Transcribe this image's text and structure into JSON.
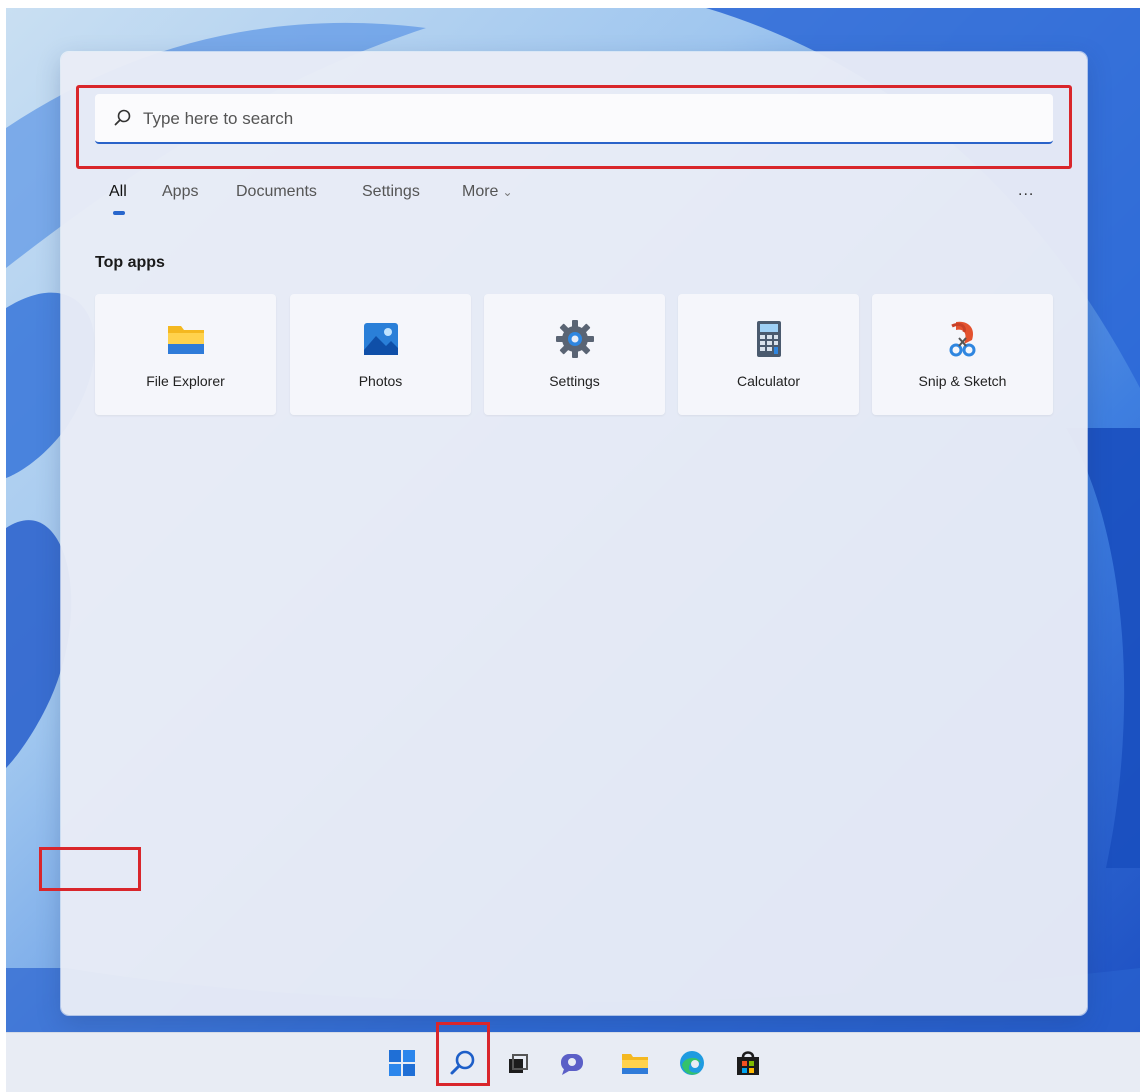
{
  "search": {
    "placeholder": "Type here to search",
    "icon": "search-icon"
  },
  "tabs": [
    {
      "label": "All",
      "active": true
    },
    {
      "label": "Apps",
      "active": false
    },
    {
      "label": "Documents",
      "active": false
    },
    {
      "label": "Settings",
      "active": false
    },
    {
      "label": "More",
      "active": false,
      "icon": "chevron-down-icon"
    }
  ],
  "overflow_menu_label": "...",
  "top_apps": {
    "heading": "Top apps",
    "items": [
      {
        "label": "File Explorer",
        "icon": "folder-icon"
      },
      {
        "label": "Photos",
        "icon": "photos-icon"
      },
      {
        "label": "Settings",
        "icon": "gear-icon"
      },
      {
        "label": "Calculator",
        "icon": "calculator-icon"
      },
      {
        "label": "Snip & Sketch",
        "icon": "snip-sketch-icon"
      }
    ]
  },
  "taskbar": {
    "items": [
      {
        "name": "start",
        "icon": "windows-start-icon"
      },
      {
        "name": "search",
        "icon": "search-icon"
      },
      {
        "name": "task-view",
        "icon": "task-view-icon"
      },
      {
        "name": "chat",
        "icon": "chat-icon"
      },
      {
        "name": "file-explorer",
        "icon": "folder-icon"
      },
      {
        "name": "edge",
        "icon": "edge-icon"
      },
      {
        "name": "store",
        "icon": "store-icon"
      }
    ]
  },
  "colors": {
    "accent": "#2866cc",
    "highlight": "#d9262b",
    "panel": "#e9ecf6"
  }
}
